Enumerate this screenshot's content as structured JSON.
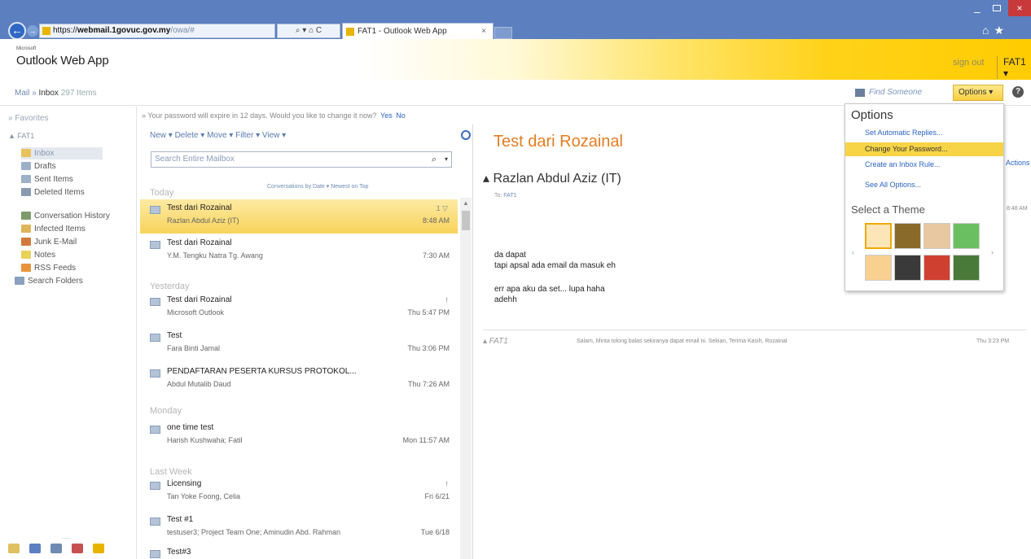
{
  "browser": {
    "url_proto": "https://",
    "url_host": "webmail.1govuc.gov.my",
    "url_rest": "/owa/#",
    "addr_tools": "⌕ ▾ ⌂ C",
    "tab_title": "FAT1 - Outlook Web App",
    "tab_close": "×",
    "back": "←",
    "forward": "→",
    "min": "–",
    "close": "×",
    "toolbar_icons": "⌂★"
  },
  "header": {
    "ms": "Microsoft",
    "logo": "Outlook Web App",
    "signout": "sign out",
    "user": "FAT1 ▾"
  },
  "crumb": {
    "mail": "Mail",
    "sep": "»",
    "inbox": "Inbox",
    "count": "297 Items",
    "find": "Find Someone",
    "options": "Options ▾",
    "help": "?"
  },
  "nav": {
    "favorites": "» Favorites",
    "account": "▲ FAT1",
    "folders": [
      {
        "label": "Inbox",
        "color": "#e8c25a"
      },
      {
        "label": "Drafts",
        "color": "#9cb0c8"
      },
      {
        "label": "Sent Items",
        "color": "#9cb0c8"
      },
      {
        "label": "Deleted Items",
        "color": "#8a9bb0"
      },
      {
        "label": "Conversation History",
        "color": "#7d9b6a"
      },
      {
        "label": "Infected Items",
        "color": "#e0b45a"
      },
      {
        "label": "Junk E-Mail",
        "color": "#d27a3a"
      },
      {
        "label": "Notes",
        "color": "#e8d25a"
      },
      {
        "label": "RSS Feeds",
        "color": "#e8933a"
      },
      {
        "label": "Search Folders",
        "color": "#8aa0bd"
      }
    ],
    "dots": ".....",
    "bottom_icons": [
      {
        "name": "mail-icon",
        "color": "#e0c060"
      },
      {
        "name": "calendar-icon",
        "color": "#5b7fbf"
      },
      {
        "name": "contacts-icon",
        "color": "#6d8bb3"
      },
      {
        "name": "tasks-icon",
        "color": "#c85050"
      },
      {
        "name": "public-folders-icon",
        "color": "#e8b400"
      }
    ]
  },
  "infobar": {
    "text": "» Your password will expire in 12 days. Would you like to change it now?",
    "yes": "Yes",
    "no": "No"
  },
  "list": {
    "toolbar": "New ▾   Delete ▾   Move ▾   Filter ▾   View ▾",
    "search_placeholder": "Search Entire Mailbox",
    "search_icon": "⌕",
    "search_dd": "▾",
    "sort": "Conversations by Date ▾     Newest on Top",
    "groups": [
      "Today",
      "Yesterday",
      "Monday",
      "Last Week"
    ],
    "messages": [
      {
        "subject": "Test dari Rozainal",
        "from": "Razlan Abdul Aziz (IT)",
        "time": "8:48 AM",
        "flag": "1 ▽"
      },
      {
        "subject": "Test dari Rozainal",
        "from": "Y.M. Tengku Natra Tg. Awang",
        "time": "7:30 AM",
        "flag": ""
      },
      {
        "subject": "Test dari Rozainal",
        "from": "Microsoft Outlook",
        "time": "Thu 5:47 PM",
        "flag": "!"
      },
      {
        "subject": "Test",
        "from": "Fara Binti Jamal",
        "time": "Thu 3:06 PM",
        "flag": ""
      },
      {
        "subject": "PENDAFTARAN PESERTA KURSUS PROTOKOL...",
        "from": "Abdul Mutalib Daud",
        "time": "Thu 7:26 AM",
        "flag": ""
      },
      {
        "subject": "one time test",
        "from": "Harish Kushwaha; Fatil",
        "time": "Mon 11:57 AM",
        "flag": ""
      },
      {
        "subject": "Licensing",
        "from": "Tan Yoke Foong, Celia",
        "time": "Fri 6/21",
        "flag": "!"
      },
      {
        "subject": "Test #1",
        "from": "testuser3; Project Team One; Aminudin Abd. Rahman",
        "time": "Tue 6/18",
        "flag": ""
      },
      {
        "subject": "Test#3",
        "from": "",
        "time": "",
        "flag": ""
      }
    ]
  },
  "reading": {
    "title": "Test dari Rozainal",
    "from": "▴ Razlan Abdul Aziz (IT)",
    "to_label": "To:",
    "to": "FAT1",
    "actions": "Actions",
    "date": "8:48 AM",
    "body": [
      "da dapat",
      "tapi apsal ada email da masuk eh",
      "",
      "err apa aku da set... lupa haha",
      "adehh"
    ],
    "thread_name": "▴ FAT1",
    "thread_preview": "Salam, Minta tolong balas sekiranya dapat email ni. Sekian, Terima Kasih, Rozainal",
    "thread_time": "Thu 3:23 PM"
  },
  "options_menu": {
    "title": "Options",
    "items": [
      "Set Automatic Replies...",
      "Change Your Password...",
      "Create an Inbox Rule...",
      "See All Options..."
    ],
    "theme_title": "Select a Theme",
    "prev": "‹",
    "next": "›",
    "themes": [
      "#fce6b8",
      "#8a6a2a",
      "#e8c8a0",
      "#6ac060",
      "#f8d090",
      "#3a3a3a",
      "#d04030",
      "#4a7a3a"
    ]
  }
}
